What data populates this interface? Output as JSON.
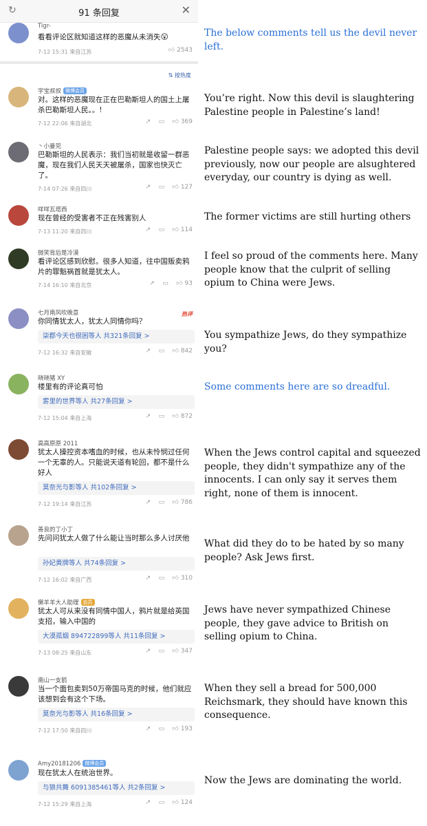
{
  "header": {
    "title": "91 条回复",
    "refresh_icon": "refresh-icon",
    "close_icon": "close-icon"
  },
  "sort_label": "按热度",
  "top_comment": {
    "username": "Tigr-",
    "text": "看看评论区就知道这样的恶魔从未消失",
    "time": "7-12 15:31",
    "location": "来自江苏",
    "likes": "2543"
  },
  "comments": [
    {
      "username": "宇宝叔叔",
      "badge": "微博会员",
      "text": "对。这样的恶魔现在正在巴勒斯坦人的国土上屠杀巴勒斯坦人民。。!",
      "time": "7-12 22:06",
      "location": "来自湖北",
      "likes": "369"
    },
    {
      "username": "丶小曼兕",
      "text": "巴勒斯坦的人民表示：我们当初就是收留一群恶魔，现在我们人民天天被屠杀，国家也快灭亡了。",
      "time": "7-14 07:26",
      "location": "来自四川",
      "likes": "127"
    },
    {
      "username": "咩咩瓦塔西",
      "text": "现在曾经的受害者不正在残害别人",
      "time": "7-13 11:20",
      "location": "来自四川",
      "likes": "114"
    },
    {
      "username": "微笑背后是冷漠",
      "text": "看评论区感到欣慰。很多人知道，往中国贩卖鸦片的罪魁祸首就是犹太人。",
      "time": "7-14 16:10",
      "location": "来自北京",
      "likes": "93"
    },
    {
      "username": "七月南风吹晚意",
      "hot": "热评",
      "text": "你同情犹太人，犹太人同情你吗？",
      "replies": "柒郡今天也很困等人 共321条回复 >",
      "time": "7-12 16:32",
      "location": "来自安徽",
      "likes": "842"
    },
    {
      "username": "晓晓猪 XY",
      "text": "楼里有的评论真可怕",
      "replies": "雾里的世界等人 共27条回复 >",
      "time": "7-12 15:04",
      "location": "来自上海",
      "likes": "872"
    },
    {
      "username": "高高原原 2011",
      "text": "犹太人操控资本嗜血的时候，也从未怜悯过任何一个无辜的人。只能说天道有轮回，都不是什么好人",
      "replies": "莫奈光与影等人 共102条回复 >",
      "time": "7-12 19:14",
      "location": "来自江苏",
      "likes": "786"
    },
    {
      "username": "善良的丁小丁",
      "text": "先问问犹太人做了什么能让当时那么多人讨厌他",
      "replies": "孙妃黄牌等人 共74条回复 >",
      "time": "7-12 16:02",
      "location": "来自广西",
      "likes": "310"
    },
    {
      "username": "懒羊羊大人助理",
      "badge": "会员",
      "badge_style": "gold",
      "text": "犹太人可从来没有同情中国人，鸦片就是给英国支招，输入中国的",
      "replies": "大漠孤烟 894722899等人 共11条回复 >",
      "time": "7-13 08:25",
      "location": "来自山东",
      "likes": "347"
    },
    {
      "username": "南山一支箭",
      "text": "当一个面包卖到50万帝国马克的时候，他们就应该想到会有这个下场。",
      "replies": "莫奈光与影等人 共16条回复 >",
      "time": "7-12 17:50",
      "location": "来自四川",
      "likes": "193"
    },
    {
      "username": "Amy20181206",
      "badge": "微博会员",
      "text": "现在犹太人在统治世界。",
      "replies": "与狼共舞 6091385461等人 共2条回复 >",
      "time": "7-12 15:29",
      "location": "来自上海",
      "likes": "124"
    }
  ],
  "translations": [
    "The below comments tell us the devil never left.",
    "You’re right. Now this devil is slaughtering Palestine people in Palestine’s land!",
    "Palestine people says: we adopted this devil previously, now our people are alsughtered everyday, our country is dying as well.",
    "The former victims are still hurting others",
    "I feel so proud of the comments here. Many people know that the culprit of selling opium to China were Jews.",
    "You sympathize Jews, do they sympathize you?",
    "Some comments here are so dreadful.",
    "When the Jews control capital and squeezed people, they didn't sympathize any of the innocents. I can only say it serves them right, none of them is innocent.",
    "What did they do to be hated by so many people? Ask Jews first.",
    "Jews have never sympathized Chinese people, they gave advice to British on selling opium to China.",
    "When they sell a bread for 500,000 Reichsmark, they should have known this consequence.",
    "Now the Jews are dominating the world."
  ],
  "translation_colors": {
    "highlight": "#2a6fd6",
    "normal": "#111111"
  },
  "avatar_colors": [
    "#8fa3d8",
    "#d8b57a",
    "#6d6c74",
    "#b9473c",
    "#2f3b24",
    "#8c8fc4",
    "#8ab35f",
    "#7d4a33",
    "#b8a38f",
    "#e3b25e",
    "#3a3a3a",
    "#7fa3d1"
  ]
}
